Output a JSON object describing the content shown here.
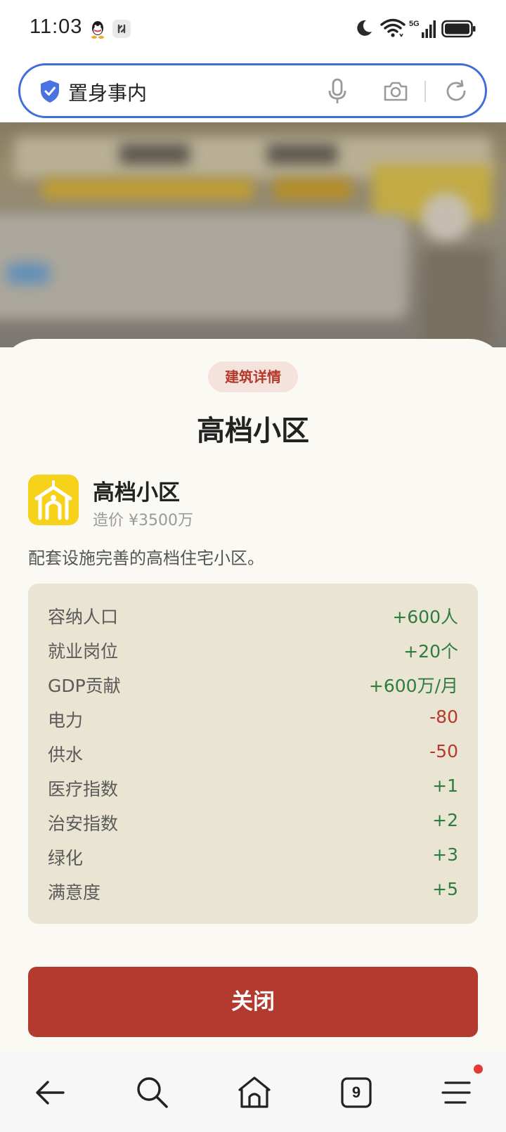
{
  "status_bar": {
    "time": "11:03",
    "network": "5G"
  },
  "browser": {
    "address_text": "置身事内",
    "tab_count": "9",
    "accent_color": "#3e6fd8"
  },
  "modal": {
    "badge": "建筑详情",
    "title": "高档小区",
    "building": {
      "icon": "residential-building-icon",
      "name": "高档小区",
      "cost": "造价 ¥3500万",
      "description": "配套设施完善的高档住宅小区。"
    },
    "stats": [
      {
        "label": "容纳人口",
        "value": "+600人",
        "tone": "pos"
      },
      {
        "label": "就业岗位",
        "value": "+20个",
        "tone": "pos"
      },
      {
        "label": "GDP贡献",
        "value": "+600万/月",
        "tone": "pos"
      },
      {
        "label": "电力",
        "value": "-80",
        "tone": "neg"
      },
      {
        "label": "供水",
        "value": "-50",
        "tone": "neg"
      },
      {
        "label": "医疗指数",
        "value": "+1",
        "tone": "pos"
      },
      {
        "label": "治安指数",
        "value": "+2",
        "tone": "pos"
      },
      {
        "label": "绿化",
        "value": "+3",
        "tone": "pos"
      },
      {
        "label": "满意度",
        "value": "+5",
        "tone": "pos"
      }
    ],
    "close_label": "关闭",
    "colors": {
      "positive": "#2e7d3e",
      "negative": "#b5392c",
      "primary_button": "#b23a2e"
    }
  }
}
